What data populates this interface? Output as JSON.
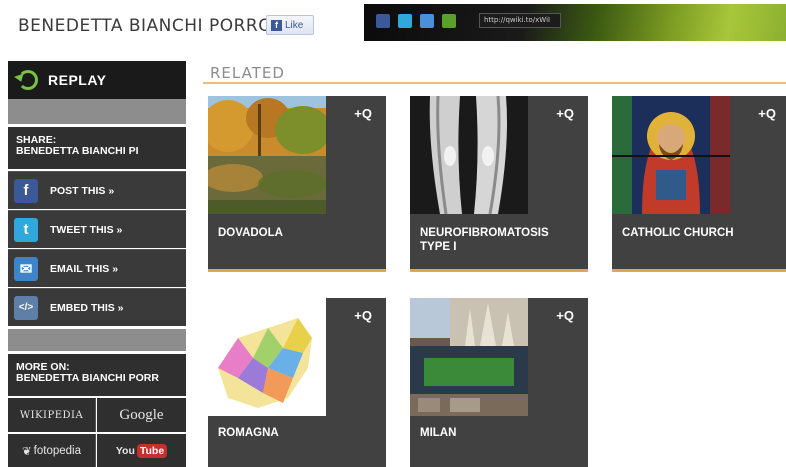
{
  "header": {
    "title": "BENEDETTA BIANCHI PORRO",
    "like_label": "Like",
    "share_url": "http://qwiki.to/xWiI"
  },
  "sidebar": {
    "replay_label": "REPLAY",
    "share_heading": "SHARE:",
    "share_subject": "BENEDETTA BIANCHI PI",
    "actions": [
      {
        "label": "POST THIS »",
        "icon": "facebook-icon",
        "color": "#3b5998"
      },
      {
        "label": "TWEET THIS »",
        "icon": "twitter-icon",
        "color": "#2fa8dc"
      },
      {
        "label": "EMAIL THIS »",
        "icon": "email-icon",
        "color": "#3f84c8"
      },
      {
        "label": "EMBED THIS »",
        "icon": "embed-icon",
        "color": "#5d7fa8"
      }
    ],
    "more_heading": "MORE ON:",
    "more_subject": "BENEDETTA BIANCHI PORR",
    "sources": {
      "wikipedia": "WIKIPEDIA",
      "google": "Google",
      "fotopedia": "fotopedia",
      "youtube_you": "You",
      "youtube_tube": "Tube"
    }
  },
  "main": {
    "related_heading": "RELATED",
    "cards": [
      {
        "name": "DOVADOLA",
        "zoom": "+Q"
      },
      {
        "name": "NEUROFIBROMATOSIS TYPE I",
        "zoom": "+Q"
      },
      {
        "name": "CATHOLIC CHURCH",
        "zoom": "+Q"
      },
      {
        "name": "ROMAGNA",
        "zoom": "+Q"
      },
      {
        "name": "MILAN",
        "zoom": "+Q"
      }
    ]
  },
  "colors": {
    "accent_orange": "#e3a64f",
    "sidebar_dark": "#2f2f2f",
    "card_bg": "#414141",
    "replay_green": "#7cc242"
  }
}
